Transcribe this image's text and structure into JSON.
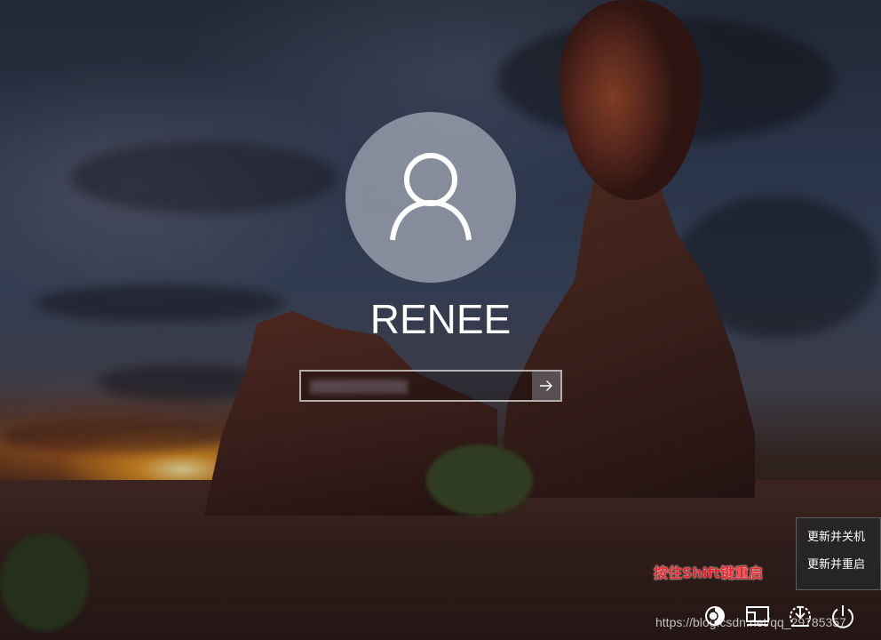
{
  "user": {
    "name": "RENEE"
  },
  "password": {
    "placeholder": "",
    "value": ""
  },
  "power_menu": {
    "items": [
      {
        "label": "更新并关机"
      },
      {
        "label": "更新并重启"
      }
    ]
  },
  "annotation": "按住Shift键重启",
  "watermark": "https://blog.csdn.net/qq_29785357",
  "icons": {
    "ease_of_access": "ease-of-access-icon",
    "display": "display-icon",
    "network": "network-icon",
    "power": "power-icon",
    "submit": "arrow-right-icon",
    "avatar": "user-icon"
  },
  "colors": {
    "annotation": "#e8262c",
    "text": "#ffffff"
  }
}
